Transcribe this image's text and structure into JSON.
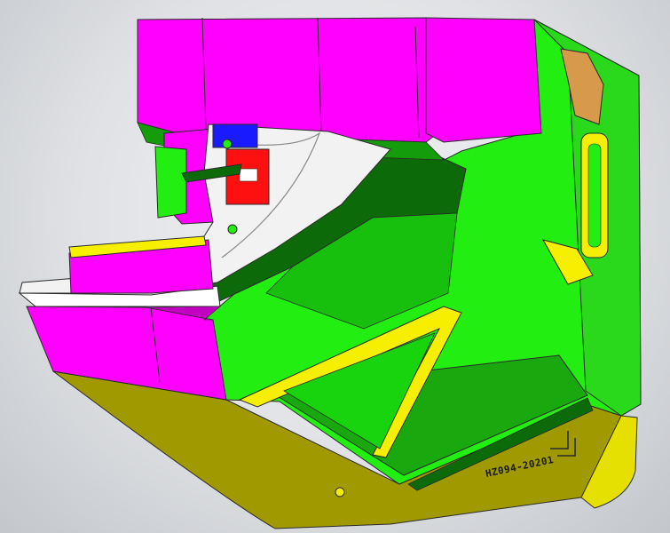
{
  "part": {
    "engraved_code": "HZ094-20201"
  },
  "colors": {
    "background": "#dcdee1",
    "insert_face": "#ff00ff",
    "insert_shadow": "#c200c2",
    "main_face": "#22ee11",
    "main_shadow": "#149c0b",
    "main_dark": "#0c6a08",
    "base_face": "#a09a00",
    "base_dark": "#6e6a00",
    "highlight": "#f6f000",
    "cavity": "#f2f2f2",
    "marker_red": "#ff1010",
    "marker_blue": "#1a1aff",
    "boss": "#d79a4a",
    "outline": "#2a2a2a"
  }
}
